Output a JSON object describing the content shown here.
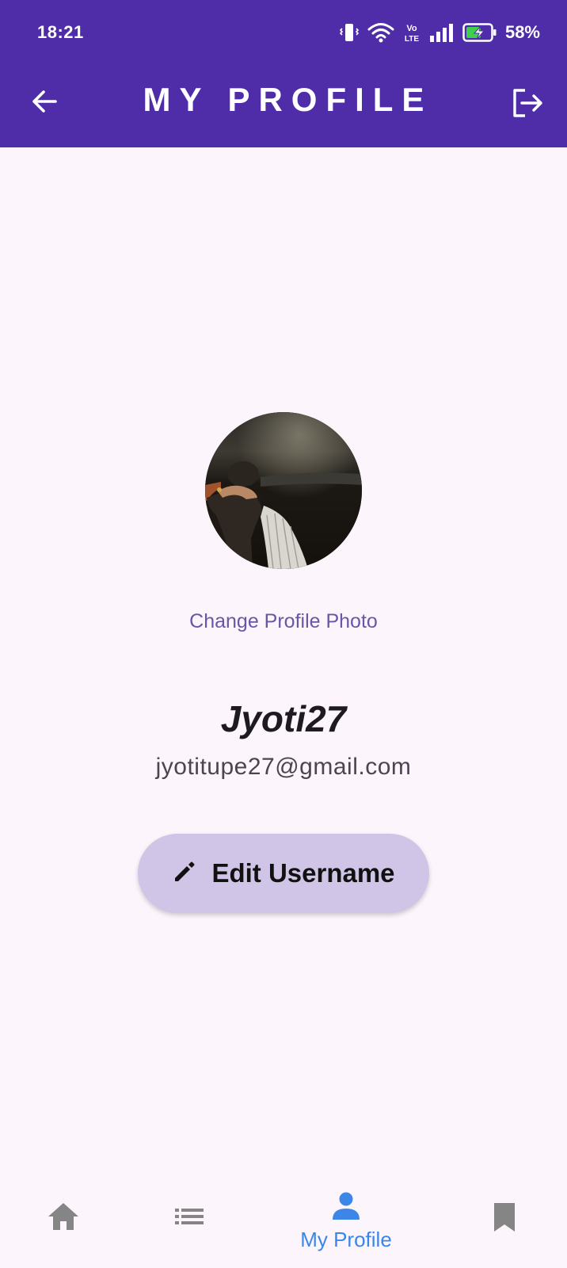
{
  "status_bar": {
    "time": "18:21",
    "battery_percent": "58%",
    "icons": [
      "vibrate-icon",
      "wifi-icon",
      "volte-icon",
      "signal-icon",
      "battery-charging-icon"
    ]
  },
  "app_bar": {
    "title": "MY PROFILE",
    "back_icon": "arrow-back-icon",
    "logout_icon": "logout-icon"
  },
  "profile": {
    "change_photo_label": "Change Profile Photo",
    "username": "Jyoti27",
    "email": "jyotitupe27@gmail.com",
    "edit_button_label": "Edit Username",
    "edit_icon": "pencil-icon"
  },
  "bottom_nav": {
    "items": [
      {
        "icon": "home-icon",
        "label": "",
        "active": false
      },
      {
        "icon": "list-icon",
        "label": "",
        "active": false
      },
      {
        "icon": "person-icon",
        "label": "My Profile",
        "active": true
      },
      {
        "icon": "bookmark-icon",
        "label": "",
        "active": false
      }
    ]
  },
  "colors": {
    "header": "#4f2ca8",
    "background": "#fcf5fc",
    "accent_link": "#6b55a6",
    "button_bg": "#d0c5e7",
    "nav_active": "#3c86e8",
    "nav_inactive": "#858585"
  }
}
